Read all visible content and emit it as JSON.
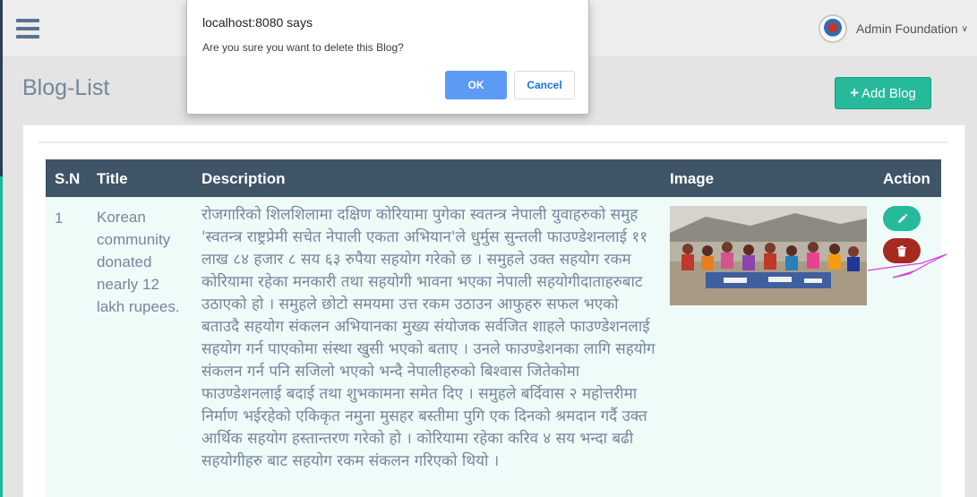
{
  "dialog": {
    "title": "localhost:8080 says",
    "message": "Are you sure you want to delete this Blog?",
    "ok_label": "OK",
    "cancel_label": "Cancel"
  },
  "topbar": {
    "menu_icon": "hamburger-icon",
    "user_name": "Admin Foundation",
    "caret": "chevron-down-icon"
  },
  "page": {
    "title": "Blog-List",
    "add_button_label": "Add Blog",
    "add_button_icon": "+"
  },
  "table": {
    "headers": [
      "S.N",
      "Title",
      "Description",
      "Image",
      "Action"
    ],
    "rows": [
      {
        "sn": "1",
        "title": "Korean community donated nearly 12 lakh rupees.",
        "description": "रोजगारिको शिलशिलामा दक्षिण कोरियामा पुगेका स्वतन्त्र नेपाली युवाहरुको समुह 'स्वतन्त्र राष्ट्रप्रेमी सचेत नेपाली एकता अभियान'ले धुर्मुस सुन्तली फाउण्डेशनलाई ११ लाख ८४ हजार ८ सय ६३ रुपैया सहयोग गरेको छ । समुहले उक्त सहयोग रकम कोरियामा रहेका मनकारी तथा सहयोगी भावना भएका नेपाली सहयोगीदाताहरुबाट उठाएको हो । समुहले छोटो समयमा उत्त रकम उठाउन आफुहरु सफल भएको बताउदै सहयोग संकलन अभियानका मुख्य संयोजक सर्वजित शाहले फाउण्डेशनलाई सहयोग गर्न पाएकोमा संस्था खुसी भएको बताए । उनले फाउण्डेशनका लागि सहयोग संकलन गर्न पनि सजिलो भएको भन्दै नेपालीहरुको बिश्वास जितेकोमा फाउण्डेशनलाई बदाई तथा शुभकामना समेत दिए । समुहले बर्दिवास २ महोत्तरीमा निर्माण भईरहेको एकिकृत नमुना मुसहर बस्तीमा पुगि एक दिनको श्रमदान गर्दै उक्त आर्थिक सहयोग हस्तान्तरण गरेको हो । कोरियामा रहेका करिव ४ सय भन्दा बढी सहयोगीहरु बाट सहयोग रकम संकलन गरिएको थियो ।",
        "image_alt": "children seated outdoors",
        "edit_icon": "pencil-icon",
        "delete_icon": "trash-icon"
      }
    ]
  },
  "colors": {
    "accent": "#26b99a",
    "table_header": "#405467",
    "delete": "#a52a20",
    "dialog_ok": "#5b9af5"
  }
}
